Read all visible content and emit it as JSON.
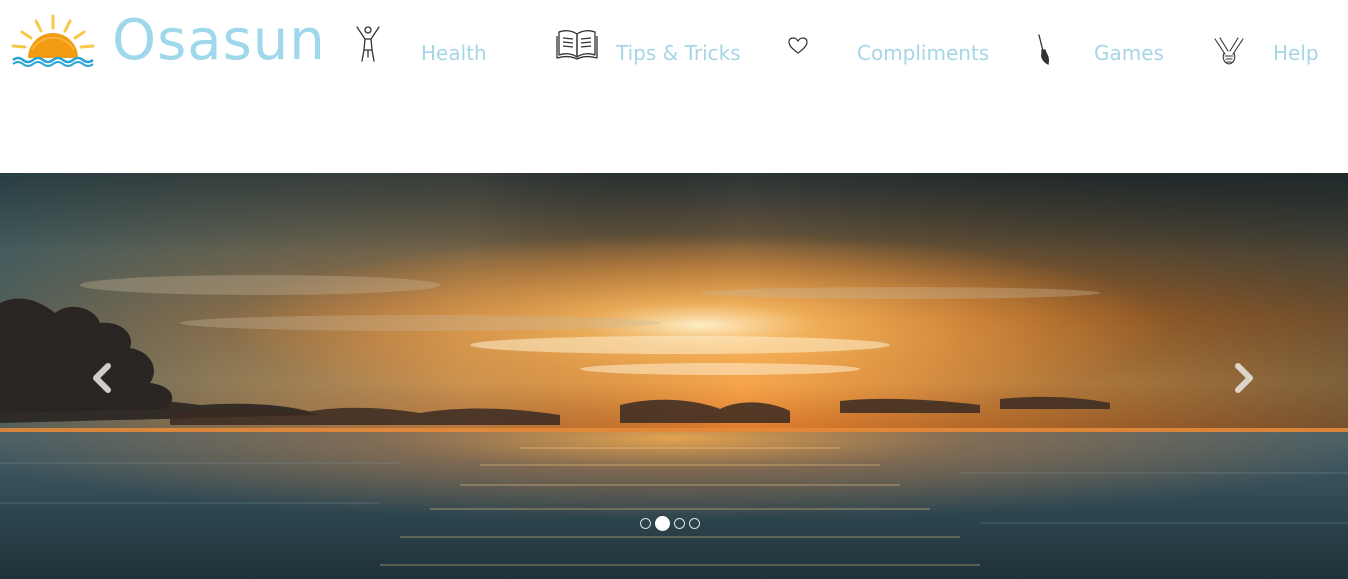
{
  "brand": {
    "name": "Osasun",
    "logo_icon": "sunset-sun-icon"
  },
  "nav": [
    {
      "label": "Health",
      "icon": "standing-figure-icon"
    },
    {
      "label": "Tips & Tricks",
      "icon": "open-book-icon"
    },
    {
      "label": "Compliments",
      "icon": "heart-icon"
    },
    {
      "label": "Games",
      "icon": "paintbrush-icon"
    },
    {
      "label": "Help",
      "icon": "holding-hands-icon"
    }
  ],
  "slideshow": {
    "image": "ocean-sunset",
    "prev_icon": "chevron-left-icon",
    "next_icon": "chevron-right-icon",
    "slide_count": 4,
    "active_slide": 2
  },
  "colors": {
    "brand": "#9fd8ea",
    "nav_text": "#a6d6e6",
    "sun": "#f39c12",
    "rays": "#f7c948",
    "water": "#29a3d6"
  }
}
